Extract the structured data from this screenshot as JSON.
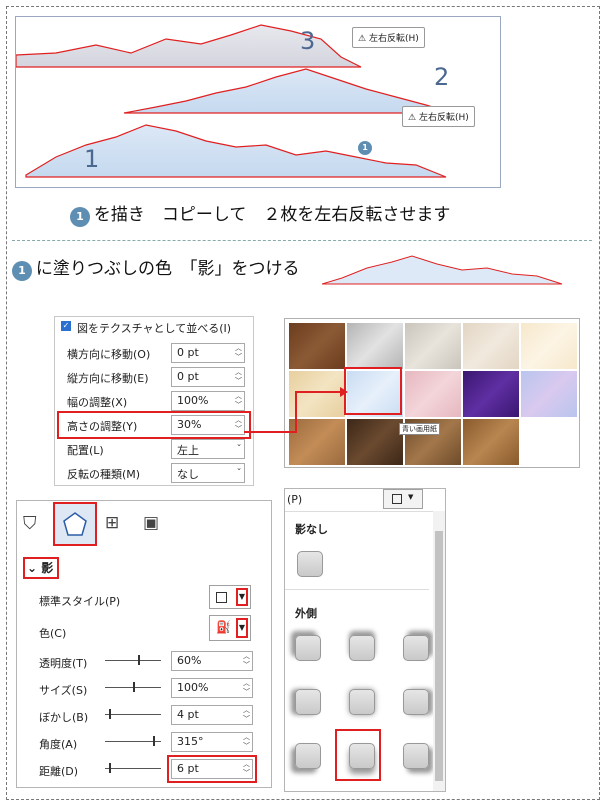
{
  "step1": {
    "num1": "3",
    "num2": "2",
    "num3": "1",
    "badge": "1",
    "flip_btn_a": "左右反転(H)",
    "flip_btn_b": "左右反転(H)",
    "caption_badge": "1",
    "caption": "を描き　コピーして　２枚を左右反転させます"
  },
  "step2": {
    "badge": "1",
    "caption": "に塗りつぶしの色　「影」をつける"
  },
  "texture_panel": {
    "checkbox_label": "図をテクスチャとして並べる(I)",
    "rows": [
      {
        "label": "横方向に移動(O)",
        "value": "0 pt"
      },
      {
        "label": "縦方向に移動(E)",
        "value": "0 pt"
      },
      {
        "label": "幅の調整(X)",
        "value": "100%"
      },
      {
        "label": "高さの調整(Y)",
        "value": "30%"
      },
      {
        "label": "配置(L)",
        "value": "左上"
      },
      {
        "label": "反転の種類(M)",
        "value": "なし"
      }
    ]
  },
  "texture_gallery": {
    "tooltip": "青い画用紙"
  },
  "shadow_panel": {
    "section": "影",
    "preset_label": "標準スタイル(P)",
    "color_label": "色(C)",
    "rows": [
      {
        "label": "透明度(T)",
        "value": "60%",
        "level": 0.6
      },
      {
        "label": "サイズ(S)",
        "value": "100%",
        "level": 0.5
      },
      {
        "label": "ぼかし(B)",
        "value": "4 pt",
        "level": 0.04
      },
      {
        "label": "角度(A)",
        "value": "315°",
        "level": 0.875
      },
      {
        "label": "距離(D)",
        "value": "6 pt",
        "level": 0.03
      }
    ]
  },
  "shadow_gallery": {
    "top_label": "(P)",
    "none_label": "影なし",
    "outer_label": "外側"
  },
  "colors": {
    "accent_red": "#e02020",
    "badge_blue": "#5e8fb3",
    "mountain_fill": "#cfe0f2"
  }
}
